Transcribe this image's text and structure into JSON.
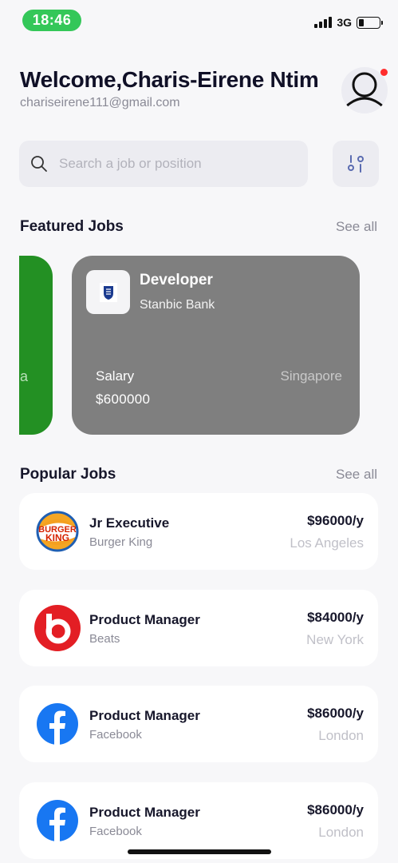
{
  "status_bar": {
    "time": "18:46",
    "network": "3G"
  },
  "header": {
    "welcome": "Welcome,Charis-Eirene Ntim",
    "email": "chariseirene111@gmail.com"
  },
  "search": {
    "placeholder": "Search a job or position"
  },
  "featured": {
    "title": "Featured Jobs",
    "see_all": "See all",
    "partial_card_text": "a",
    "card": {
      "job_title": "Developer",
      "company": "Stanbic Bank",
      "salary_label": "Salary",
      "salary": "$600000",
      "location": "Singapore"
    }
  },
  "popular": {
    "title": "Popular Jobs",
    "see_all": "See all",
    "items": [
      {
        "title": "Jr Executive",
        "company": "Burger King",
        "pay": "$96000/y",
        "location": "Los Angeles",
        "logo": "burger-king-logo"
      },
      {
        "title": "Product Manager",
        "company": "Beats",
        "pay": "$84000/y",
        "location": "New York",
        "logo": "beats-logo"
      },
      {
        "title": "Product Manager",
        "company": "Facebook",
        "pay": "$86000/y",
        "location": "London",
        "logo": "facebook-logo"
      },
      {
        "title": "Product Manager",
        "company": "Facebook",
        "pay": "$86000/y",
        "location": "London",
        "logo": "facebook-logo"
      }
    ]
  },
  "colors": {
    "accent_green": "#239023",
    "featured_card": "#7f7f7f",
    "status_green": "#34c759",
    "notification": "#ff2d2d",
    "facebook_blue": "#1877f2",
    "beats_red": "#e31e24"
  }
}
